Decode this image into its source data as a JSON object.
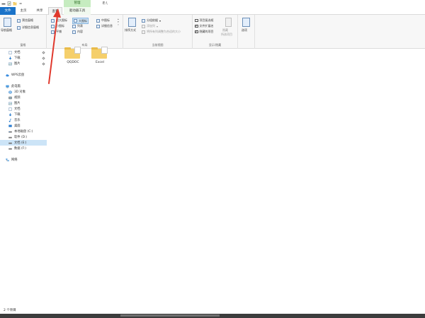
{
  "window": {
    "title": "E:\\",
    "context_tab": "管理"
  },
  "tabs": {
    "file": "文件",
    "home": "主页",
    "share": "共享",
    "view": "查看",
    "drive_tools": "驱动器工具"
  },
  "ribbon": {
    "panes": {
      "nav_pane": "导航窗格",
      "preview_pane": "预览窗格",
      "details_pane": "详细信息窗格",
      "label": "窗格"
    },
    "layout": {
      "extra_large": "超大图标",
      "large": "大图标",
      "medium": "中图标",
      "small": "小图标",
      "list": "列表",
      "details": "详细信息",
      "tiles": "平铺",
      "content": "内容",
      "label": "布局"
    },
    "current_view": {
      "sort": "排序方式",
      "group": "分组依据",
      "add_columns": "添加列",
      "size_all_columns": "将所有列调整为合适的大小",
      "label": "当前视图"
    },
    "show_hide": {
      "item_checkboxes": "项目复选框",
      "file_extensions": "文件扩展名",
      "hidden_items": "隐藏的项目",
      "hide_selected": "隐藏",
      "hide_selected_sub": "所选项目",
      "label": "显示/隐藏",
      "states": {
        "item_checkboxes": false,
        "file_extensions": true,
        "hidden_items": true
      }
    },
    "options": "选项"
  },
  "nav": {
    "quick": [
      {
        "label": "文档",
        "icon": "document-icon",
        "pinned": true
      },
      {
        "label": "下载",
        "icon": "download-icon",
        "pinned": true
      },
      {
        "label": "图片",
        "icon": "picture-icon",
        "pinned": true
      }
    ],
    "wps": "WPS云盘",
    "this_pc": "此电脑",
    "pc_items": [
      {
        "label": "3D 对象",
        "icon": "3d-objects-icon"
      },
      {
        "label": "视频",
        "icon": "video-icon"
      },
      {
        "label": "图片",
        "icon": "picture-icon"
      },
      {
        "label": "文档",
        "icon": "document-icon"
      },
      {
        "label": "下载",
        "icon": "download-icon"
      },
      {
        "label": "音乐",
        "icon": "music-icon"
      },
      {
        "label": "桌面",
        "icon": "desktop-icon"
      },
      {
        "label": "本地磁盘 (C:)",
        "icon": "drive-icon"
      },
      {
        "label": "软件 (D:)",
        "icon": "drive-icon"
      },
      {
        "label": "文档 (E:)",
        "icon": "drive-icon",
        "selected": true
      },
      {
        "label": "数据 (F:)",
        "icon": "drive-icon"
      }
    ],
    "network": "网络"
  },
  "files": [
    {
      "name": "QQDOC"
    },
    {
      "name": "Excel"
    }
  ],
  "status": {
    "item_count": "2 个项目"
  },
  "colors": {
    "accent": "#1a73c9",
    "context_tab": "#c6ecc0",
    "folder": "#f5cf6b",
    "selection": "#cce4f7",
    "annotation_arrow": "#e0382c"
  }
}
